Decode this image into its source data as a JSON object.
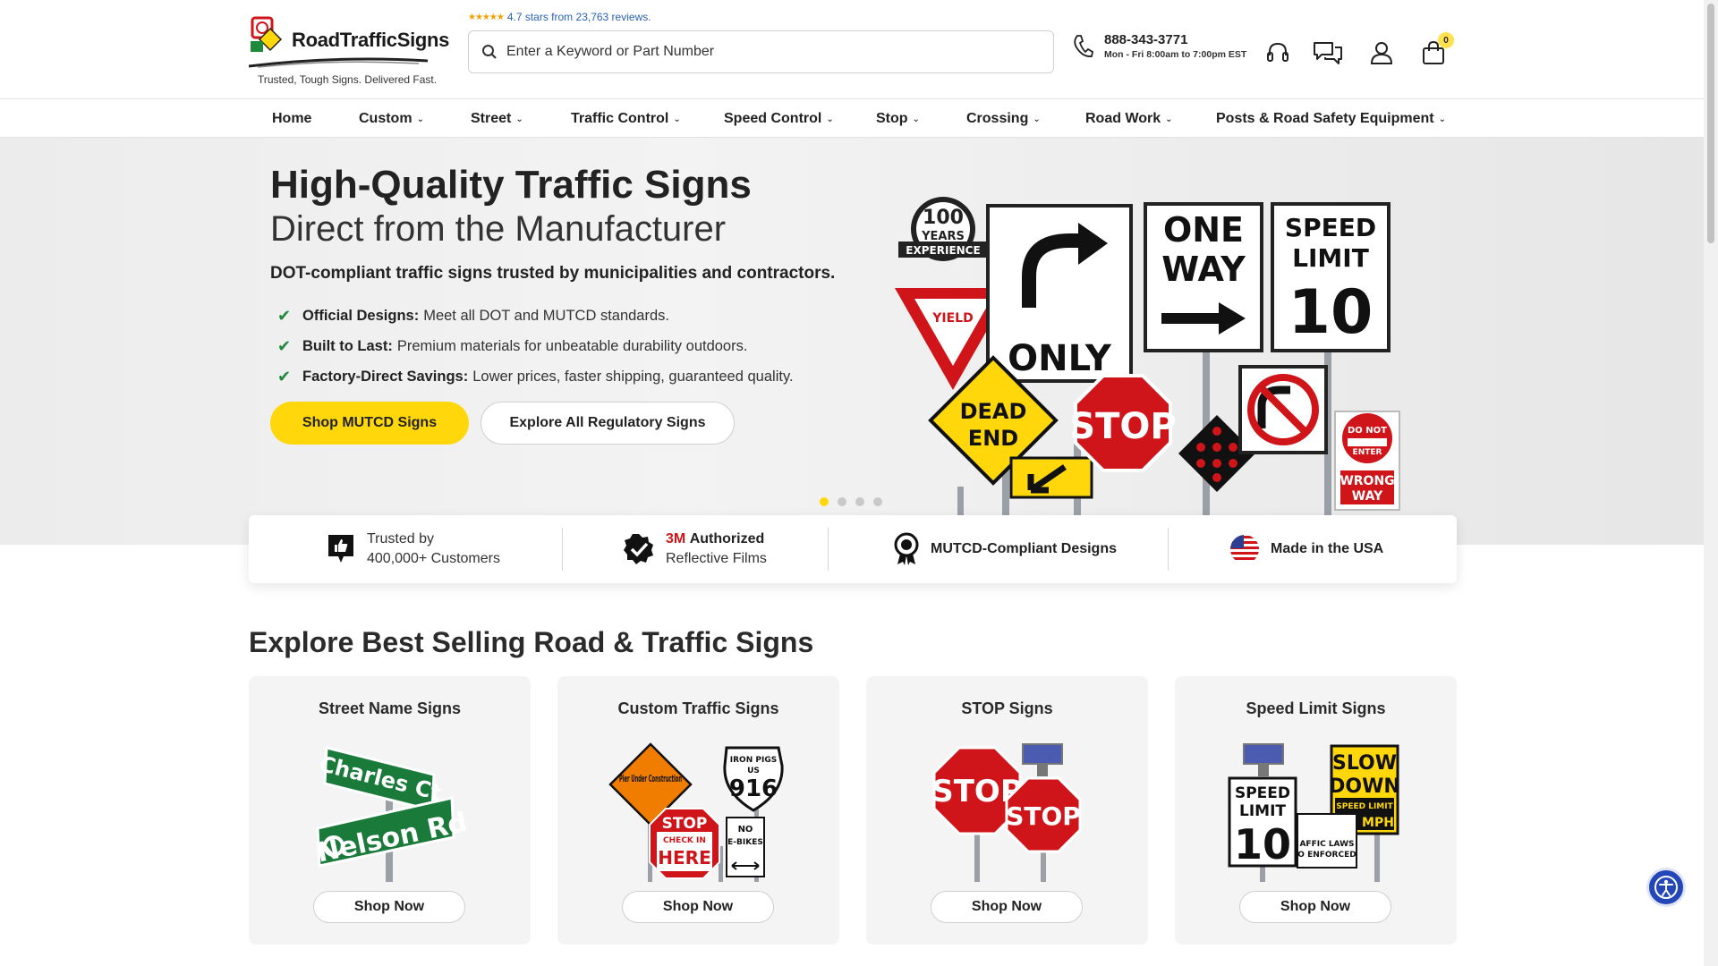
{
  "header": {
    "logo_text": "RoadTrafficSigns",
    "tagline": "Trusted, Tough Signs. Delivered Fast.",
    "rating_text": "4.7 stars from 23,763 reviews.",
    "search_placeholder": "Enter a Keyword or Part Number",
    "phone": "888-343-3771",
    "hours": "Mon - Fri 8:00am to 7:00pm EST",
    "cart_count": "0"
  },
  "nav": {
    "items": [
      {
        "label": "Home"
      },
      {
        "label": "Custom"
      },
      {
        "label": "Street"
      },
      {
        "label": "Traffic Control"
      },
      {
        "label": "Speed Control"
      },
      {
        "label": "Stop"
      },
      {
        "label": "Crossing"
      },
      {
        "label": "Road Work"
      },
      {
        "label": "Posts & Road Safety Equipment"
      }
    ]
  },
  "hero": {
    "title": "High-Quality Traffic Signs",
    "subtitle": "Direct from the Manufacturer",
    "description": "DOT-compliant traffic signs trusted by municipalities and contractors.",
    "bullets": [
      {
        "bold": "Official Designs:",
        "text": "Meet all DOT and MUTCD standards."
      },
      {
        "bold": "Built to Last:",
        "text": "Premium materials for unbeatable durability outdoors."
      },
      {
        "bold": "Factory-Direct Savings:",
        "text": "Lower prices, faster shipping, guaranteed quality."
      }
    ],
    "primary_button": "Shop MUTCD Signs",
    "secondary_button": "Explore All Regulatory Signs",
    "carousel_index": 1,
    "carousel_total": 4,
    "art": {
      "badge_line1": "100",
      "badge_line2": "YEARS",
      "badge_line3": "EXPERIENCE",
      "yield": "YIELD",
      "only": "ONLY",
      "one": "ONE",
      "way": "WAY",
      "speed": "SPEED",
      "limit": "LIMIT",
      "ten": "10",
      "dead": "DEAD",
      "end": "END",
      "stop": "STOP",
      "do_not": "DO NOT",
      "enter": "ENTER",
      "wrong": "WRONG",
      "way2": "WAY"
    }
  },
  "trust": {
    "customers_line1": "Trusted by",
    "customers_line2": "400,000+ Customers",
    "films_brand": "3M",
    "films_line1": "Authorized",
    "films_line2": "Reflective Films",
    "mutcd": "MUTCD-Compliant Designs",
    "usa": "Made in the USA"
  },
  "best_sellers": {
    "title": "Explore Best Selling Road & Traffic Signs",
    "cards": [
      {
        "title": "Street Name Signs",
        "button": "Shop Now",
        "sign1": "Charles Ct",
        "sign2": "Nelson Rd"
      },
      {
        "title": "Custom Traffic Signs",
        "button": "Shop Now",
        "sign1": "Pier Under Construction",
        "sign2": "IRON PIGS",
        "sign3": "US",
        "sign4": "916",
        "sign5": "STOP",
        "sign6": "CHECK IN",
        "sign7": "HERE",
        "sign8": "NO",
        "sign9": "E-BIKES"
      },
      {
        "title": "STOP Signs",
        "button": "Shop Now",
        "sign1": "STOP",
        "sign2": "STOP"
      },
      {
        "title": "Speed Limit Signs",
        "button": "Shop Now",
        "sign1": "SPEED",
        "sign2": "LIMIT",
        "sign3": "10",
        "sign4": "SLOW",
        "sign5": "DOWN",
        "sign6": "SPEED LIMIT",
        "sign7": "MPH",
        "sign8": "AFFIC LAWS",
        "sign9": "O ENFORCED"
      }
    ]
  },
  "colors": {
    "accent_yellow": "#ffd70a",
    "link_blue": "#2a62b7",
    "brand_red": "#d0151a",
    "check_green": "#1f8a3c",
    "a11y_blue": "#2347b8"
  }
}
